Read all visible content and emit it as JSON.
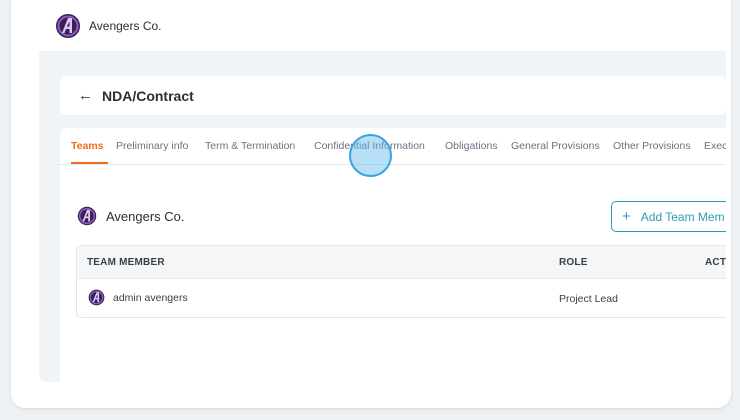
{
  "org": {
    "name": "Avengers Co."
  },
  "page": {
    "title": "NDA/Contract"
  },
  "tabs": [
    {
      "label": "Teams",
      "active": true
    },
    {
      "label": "Preliminary info"
    },
    {
      "label": "Term & Termination"
    },
    {
      "label": "Confidential Information"
    },
    {
      "label": "Obligations"
    },
    {
      "label": "General Provisions"
    },
    {
      "label": "Other Provisions"
    },
    {
      "label": "Exec"
    }
  ],
  "team": {
    "name": "Avengers Co.",
    "add_button_label": "Add Team Mem",
    "columns": [
      "TEAM MEMBER",
      "ROLE",
      "ACTI"
    ],
    "rows": [
      {
        "member": "admin avengers",
        "role": "Project Lead"
      }
    ]
  },
  "colors": {
    "accent": "#f26b1d",
    "primary": "#2c9ab7",
    "logo": "#5b2d7a"
  },
  "icons": {
    "back": "arrow-left-icon",
    "add": "plus-icon",
    "logo": "avengers-logo-icon"
  }
}
